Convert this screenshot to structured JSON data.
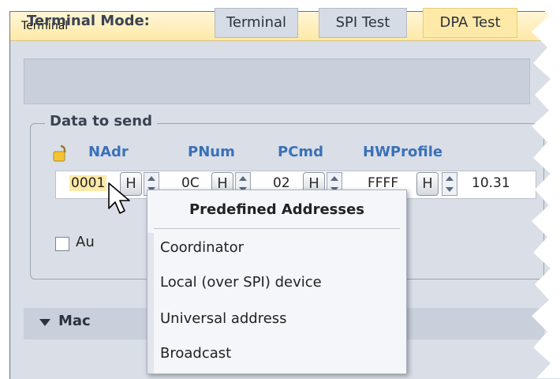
{
  "window": {
    "title": "Terminal"
  },
  "mode_bar": {
    "label": "Terminal Mode:",
    "buttons": [
      {
        "label": "Terminal",
        "active": false
      },
      {
        "label": "SPI Test",
        "active": false
      },
      {
        "label": "DPA Test",
        "active": true
      }
    ]
  },
  "data_to_send": {
    "group_title": "Data to send",
    "columns": {
      "nadr": "NAdr",
      "pnum": "PNum",
      "pcmd": "PCmd",
      "hwprofile": "HWProfile"
    },
    "values": {
      "nadr": "0001",
      "pnum": "0C",
      "pcmd": "02",
      "hwprofile": "FFFF",
      "extra": "10.31"
    },
    "hex_button_label": "H",
    "checkbox_label_partial": "Au"
  },
  "collapsed_section": {
    "label_partial": "Mac"
  },
  "context_menu": {
    "title": "Predefined Addresses",
    "items": [
      "Coordinator",
      "Local (over SPI) device",
      "Universal address",
      "Broadcast"
    ]
  },
  "colors": {
    "accent": "#ffe9a8",
    "header_blue": "#3a71b8",
    "panel": "#d9dee7"
  }
}
